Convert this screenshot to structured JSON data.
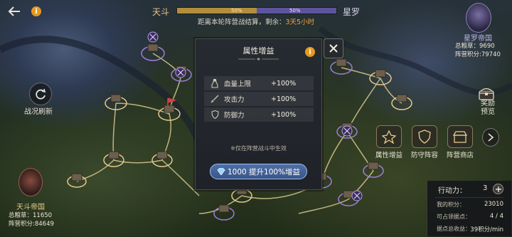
{
  "header": {
    "faction_left": "天斗",
    "faction_right": "星罗",
    "progress_left_pct": "50%",
    "progress_right_pct": "50%",
    "progress_left": 0.5,
    "countdown_prefix": "距离本轮阵营战结算，剩余：",
    "countdown_value": "3天5小时"
  },
  "right_faction": {
    "title": "星罗帝国",
    "food_label": "总粮草：9690",
    "score_label": "阵营积分:79740"
  },
  "left_faction": {
    "title": "天斗帝国",
    "food_label": "总粮草：11650",
    "score_label": "阵营积分:84649"
  },
  "refresh": {
    "label": "战况刷新"
  },
  "reward": {
    "label": "奖励预览"
  },
  "nav": [
    {
      "label": "属性增益",
      "icon": "buff-icon"
    },
    {
      "label": "防守阵容",
      "icon": "shield-icon"
    },
    {
      "label": "阵营商店",
      "icon": "shop-icon"
    }
  ],
  "stats": {
    "action_label": "行动力：",
    "action_value": "3",
    "my_score_label": "我的积分：",
    "my_score_value": "23010",
    "occupy_label": "可占领据点：",
    "occupy_value": "4 / 4",
    "income_label": "据点总收益：",
    "income_value": "39积分/min"
  },
  "modal": {
    "title": "属性增益",
    "rows": [
      {
        "label": "血量上限",
        "value": "+100%",
        "icon": "potion-icon"
      },
      {
        "label": "攻击力",
        "value": "+100%",
        "icon": "sword-icon"
      },
      {
        "label": "防御力",
        "value": "+100%",
        "icon": "shield-icon"
      }
    ],
    "note": "※仅在阵营战斗中生效",
    "boost_button": "1000 提升100%增益"
  },
  "colors": {
    "gold": "#b38d3b",
    "purple": "#5d54a0",
    "accent_orange": "#e59a1f",
    "button_blue": "#4f6fa6"
  }
}
